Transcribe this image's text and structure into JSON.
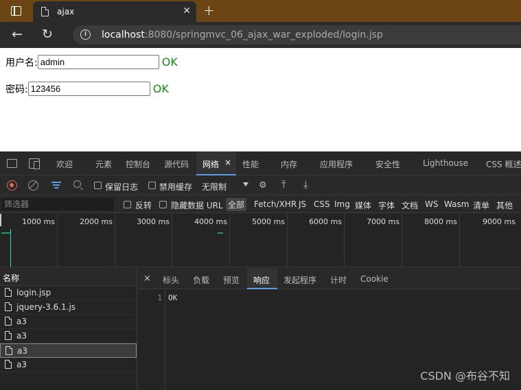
{
  "browser": {
    "tab_title": "ajax",
    "new_tab": "+",
    "url_host": "localhost",
    "url_rest": ":8080/springmvc_06_ajax_war_exploded/login.jsp"
  },
  "form": {
    "username_label": "用户名:",
    "username_value": "admin",
    "username_status": "OK",
    "password_label": "密码:",
    "password_value": "123456",
    "password_status": "OK",
    "status_color": "#168716"
  },
  "devtools": {
    "tabs": [
      "欢迎",
      "元素",
      "控制台",
      "源代码",
      "网络",
      "性能",
      "内存",
      "应用程序",
      "安全性",
      "Lighthouse",
      "CSS 概述"
    ],
    "active_tab": "网络",
    "active_tab_close": "×",
    "toolbar": {
      "preserve_log": "保留日志",
      "disable_cache": "禁用缓存",
      "throttling": "无限制"
    },
    "filter": {
      "placeholder": "筛选器",
      "invert": "反转",
      "hide_data_urls": "隐藏数据 URL",
      "types": [
        "全部",
        "Fetch/XHR",
        "JS",
        "CSS",
        "Img",
        "媒体",
        "字体",
        "文档",
        "WS",
        "Wasm",
        "清单",
        "其他"
      ],
      "active_type": "全部"
    },
    "timeline_ticks": [
      "1000 ms",
      "2000 ms",
      "3000 ms",
      "4000 ms",
      "5000 ms",
      "6000 ms",
      "7000 ms",
      "8000 ms",
      "9000 ms"
    ],
    "requests": {
      "header": "名称",
      "items": [
        "login.jsp",
        "jquery-3.6.1.js",
        "a3",
        "a3",
        "a3",
        "a3"
      ],
      "selected_index": 4
    },
    "details": {
      "close": "×",
      "tabs": [
        "标头",
        "负载",
        "预览",
        "响应",
        "发起程序",
        "计时",
        "Cookie"
      ],
      "active_tab": "响应",
      "line_number": "1",
      "response_body": "OK"
    }
  },
  "watermark": "CSDN @布谷不知",
  "colors": {
    "titlebar": "#6b4614",
    "accent": "#5e9ee8",
    "record": "#e46962"
  }
}
